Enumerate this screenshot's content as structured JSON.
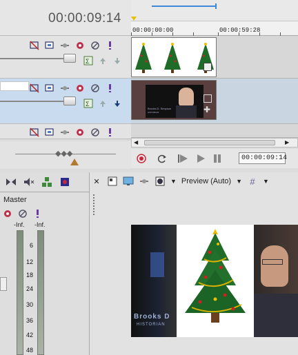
{
  "header": {
    "timecode": "00:00:09:14"
  },
  "ruler": {
    "label_start": "00:00:00:00",
    "label_end": "00:00:59:28"
  },
  "transport": {
    "timecode": "00:00:09:14"
  },
  "mixer": {
    "master_label": "Master",
    "left_peak": "-Inf.",
    "right_peak": "-Inf.",
    "scale": [
      "6",
      "12",
      "18",
      "24",
      "30",
      "36",
      "42",
      "48"
    ]
  },
  "preview": {
    "mode_label": "Preview (Auto)",
    "caption_name": "Brooks D",
    "caption_title": "HISTORIAN"
  },
  "video_clip": {
    "caption_name": "Brooks D. Simpson",
    "caption_title": "HISTORIAN"
  },
  "colors": {
    "accent": "#3b87d8",
    "selected_track": "#c9dcef",
    "record": "#c8283a"
  }
}
